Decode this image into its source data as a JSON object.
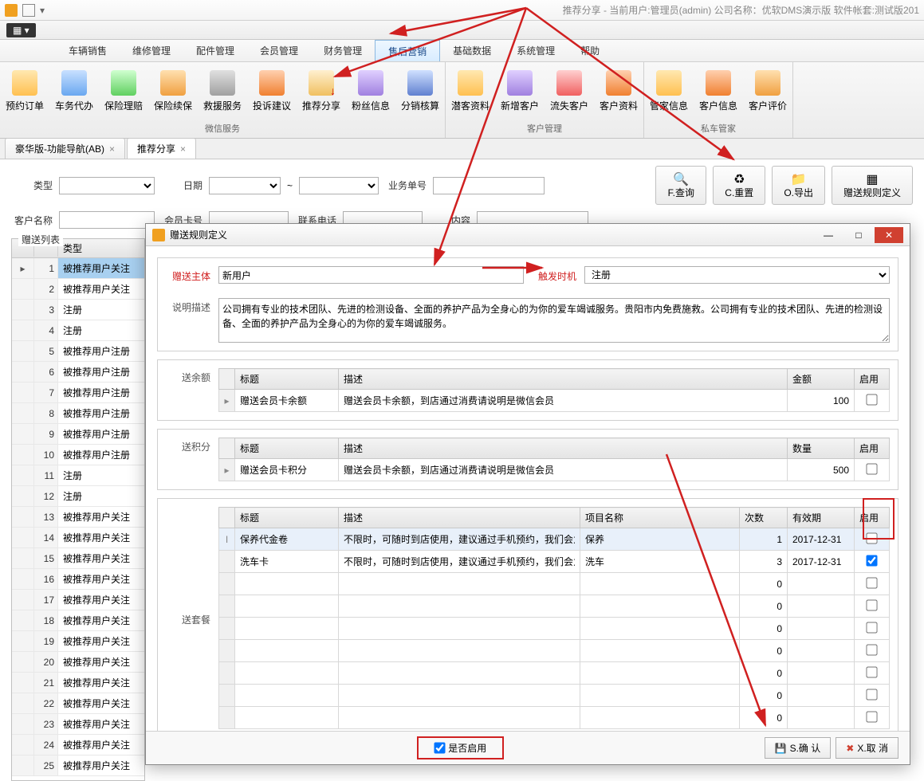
{
  "title": "推荐分享 - 当前用户:管理员(admin) 公司名称：优软DMS演示版 软件帐套:测试版201",
  "menubar": [
    "车辆销售",
    "维修管理",
    "配件管理",
    "会员管理",
    "财务管理",
    "售后营销",
    "基础数据",
    "系统管理",
    "帮助"
  ],
  "menubar_active": 5,
  "ribbon": {
    "groups": [
      {
        "title": "微信服务",
        "btns": [
          {
            "l": "预约订单",
            "ic": "ic-user"
          },
          {
            "l": "车务代办",
            "ic": "ic-car"
          },
          {
            "l": "保险理赔",
            "ic": "ic-shield"
          },
          {
            "l": "保险续保",
            "ic": "ic-doc"
          },
          {
            "l": "救援服务",
            "ic": "ic-gear"
          },
          {
            "l": "投诉建议",
            "ic": "ic-people"
          },
          {
            "l": "推荐分享",
            "ic": "ic-share"
          },
          {
            "l": "粉丝信息",
            "ic": "ic-fans"
          },
          {
            "l": "分销核算",
            "ic": "ic-calc"
          }
        ]
      },
      {
        "title": "客户管理",
        "btns": [
          {
            "l": "潜客资料",
            "ic": "ic-user"
          },
          {
            "l": "新增客户",
            "ic": "ic-fans"
          },
          {
            "l": "流失客户",
            "ic": "ic-lost"
          },
          {
            "l": "客户资料",
            "ic": "ic-people"
          }
        ]
      },
      {
        "title": "私车管家",
        "btns": [
          {
            "l": "管家信息",
            "ic": "ic-user"
          },
          {
            "l": "客户信息",
            "ic": "ic-people"
          },
          {
            "l": "客户评价",
            "ic": "ic-doc"
          }
        ]
      }
    ]
  },
  "tabs": [
    {
      "l": "豪华版-功能导航(AB)",
      "x": true
    },
    {
      "l": "推荐分享",
      "x": true,
      "active": true
    }
  ],
  "filter": {
    "labels": {
      "type": "类型",
      "date": "日期",
      "bizno": "业务单号",
      "cust": "客户名称",
      "card": "会员卡号",
      "phone": "联系电话",
      "content": "内容",
      "tilde": "~"
    },
    "btns": {
      "query": "F.查询",
      "reset": "C.重置",
      "export": "O.导出",
      "rule": "赠送规则定义"
    }
  },
  "giftlist": {
    "title": "赠送列表",
    "header": "类型",
    "rows": [
      {
        "n": 1,
        "t": "被推荐用户关注",
        "sel": true
      },
      {
        "n": 2,
        "t": "被推荐用户关注"
      },
      {
        "n": 3,
        "t": "注册"
      },
      {
        "n": 4,
        "t": "注册"
      },
      {
        "n": 5,
        "t": "被推荐用户注册"
      },
      {
        "n": 6,
        "t": "被推荐用户注册"
      },
      {
        "n": 7,
        "t": "被推荐用户注册"
      },
      {
        "n": 8,
        "t": "被推荐用户注册"
      },
      {
        "n": 9,
        "t": "被推荐用户注册"
      },
      {
        "n": 10,
        "t": "被推荐用户注册"
      },
      {
        "n": 11,
        "t": "注册"
      },
      {
        "n": 12,
        "t": "注册"
      },
      {
        "n": 13,
        "t": "被推荐用户关注"
      },
      {
        "n": 14,
        "t": "被推荐用户关注"
      },
      {
        "n": 15,
        "t": "被推荐用户关注"
      },
      {
        "n": 16,
        "t": "被推荐用户关注"
      },
      {
        "n": 17,
        "t": "被推荐用户关注"
      },
      {
        "n": 18,
        "t": "被推荐用户关注"
      },
      {
        "n": 19,
        "t": "被推荐用户关注"
      },
      {
        "n": 20,
        "t": "被推荐用户关注"
      },
      {
        "n": 21,
        "t": "被推荐用户关注"
      },
      {
        "n": 22,
        "t": "被推荐用户关注"
      },
      {
        "n": 23,
        "t": "被推荐用户关注"
      },
      {
        "n": 24,
        "t": "被推荐用户关注"
      },
      {
        "n": 25,
        "t": "被推荐用户关注"
      }
    ]
  },
  "dialog": {
    "title": "赠送规则定义",
    "subject_label": "赠送主体",
    "subject_value": "新用户",
    "trigger_label": "触发时机",
    "trigger_value": "注册",
    "desc_label": "说明描述",
    "desc_value": "公司拥有专业的技术团队、先进的检测设备、全面的养护产品为全身心的为你的爱车竭诚服务。贵阳市内免费施救。公司拥有专业的技术团队、先进的检测设备、全面的养护产品为全身心的为你的爱车竭诚服务。",
    "balance": {
      "label": "送余额",
      "cols": {
        "title": "标题",
        "desc": "描述",
        "amount": "金额",
        "enable": "启用"
      },
      "row": {
        "title": "赠送会员卡余额",
        "desc": "赠送会员卡余额，到店通过消费请说明是微信会员",
        "amount": "100",
        "enable": false
      }
    },
    "points": {
      "label": "送积分",
      "cols": {
        "title": "标题",
        "desc": "描述",
        "qty": "数量",
        "enable": "启用"
      },
      "row": {
        "title": "赠送会员卡积分",
        "desc": "赠送会员卡余额，到店通过消费请说明是微信会员",
        "qty": "500",
        "enable": false
      }
    },
    "package": {
      "label": "送套餐",
      "cols": {
        "title": "标题",
        "desc": "描述",
        "item": "项目名称",
        "times": "次数",
        "valid": "有效期",
        "enable": "启用"
      },
      "rows": [
        {
          "title": "保养代金卷",
          "desc": "不限时，可随时到店使用，建议通过手机预约，我们会为...",
          "item": "保养",
          "times": "1",
          "valid": "2017-12-31",
          "enable": false,
          "sel": true
        },
        {
          "title": "洗车卡",
          "desc": "不限时，可随时到店使用，建议通过手机预约，我们会为...",
          "item": "洗车",
          "times": "3",
          "valid": "2017-12-31",
          "enable": true
        },
        {
          "title": "",
          "desc": "",
          "item": "",
          "times": "0",
          "valid": "",
          "enable": false
        },
        {
          "title": "",
          "desc": "",
          "item": "",
          "times": "0",
          "valid": "",
          "enable": false
        },
        {
          "title": "",
          "desc": "",
          "item": "",
          "times": "0",
          "valid": "",
          "enable": false
        },
        {
          "title": "",
          "desc": "",
          "item": "",
          "times": "0",
          "valid": "",
          "enable": false
        },
        {
          "title": "",
          "desc": "",
          "item": "",
          "times": "0",
          "valid": "",
          "enable": false
        },
        {
          "title": "",
          "desc": "",
          "item": "",
          "times": "0",
          "valid": "",
          "enable": false
        },
        {
          "title": "",
          "desc": "",
          "item": "",
          "times": "0",
          "valid": "",
          "enable": false
        }
      ]
    },
    "enable_all": "是否启用",
    "buttons": {
      "ok": "S.确 认",
      "cancel": "X.取 消"
    }
  }
}
